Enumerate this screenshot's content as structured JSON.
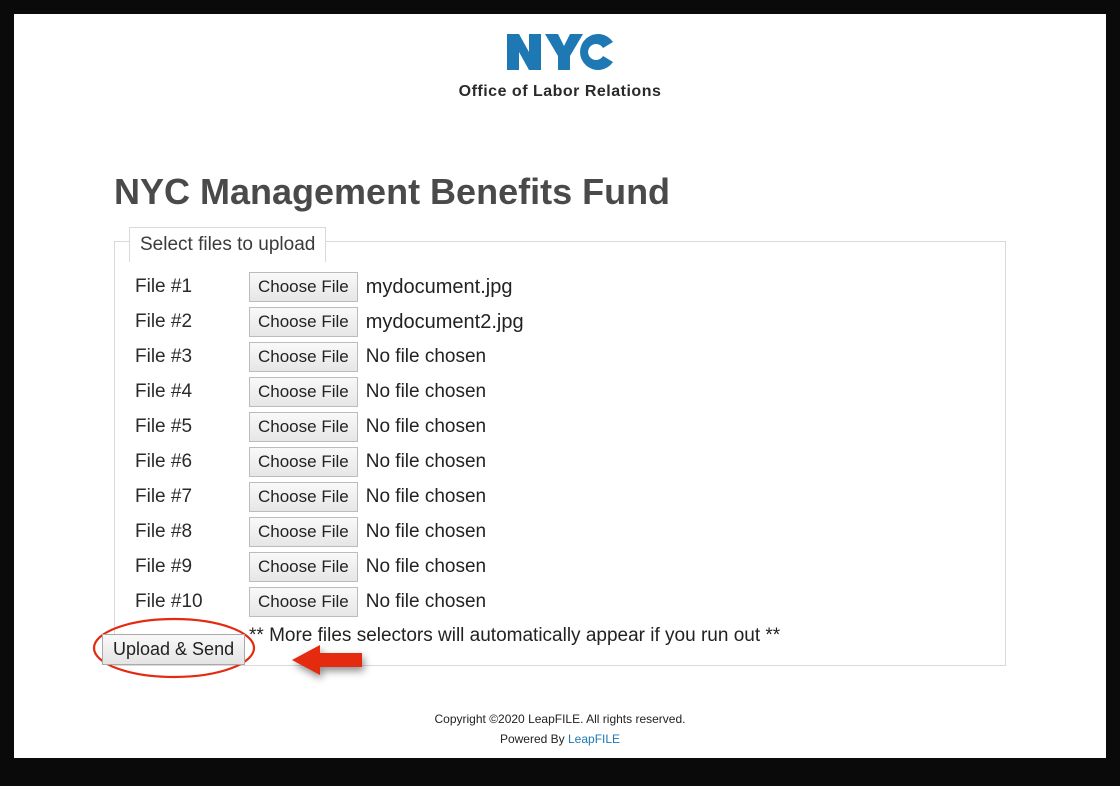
{
  "header": {
    "logo_text": "NYC",
    "subtitle": "Office of Labor Relations"
  },
  "main": {
    "title": "NYC Management Benefits Fund",
    "fieldset_legend": "Select files to upload",
    "choose_button_label": "Choose File",
    "no_file_label": "No file chosen",
    "files": [
      {
        "label": "File #1",
        "filename": "mydocument.jpg",
        "chosen": true
      },
      {
        "label": "File #2",
        "filename": "mydocument2.jpg",
        "chosen": true
      },
      {
        "label": "File #3",
        "filename": "No file chosen",
        "chosen": false
      },
      {
        "label": "File #4",
        "filename": "No file chosen",
        "chosen": false
      },
      {
        "label": "File #5",
        "filename": "No file chosen",
        "chosen": false
      },
      {
        "label": "File #6",
        "filename": "No file chosen",
        "chosen": false
      },
      {
        "label": "File #7",
        "filename": "No file chosen",
        "chosen": false
      },
      {
        "label": "File #8",
        "filename": "No file chosen",
        "chosen": false
      },
      {
        "label": "File #9",
        "filename": "No file chosen",
        "chosen": false
      },
      {
        "label": "File #10",
        "filename": "No file chosen",
        "chosen": false
      }
    ],
    "hint": "** More files selectors will automatically appear if you run out **",
    "upload_button_label": "Upload & Send"
  },
  "annotation": {
    "arrow_color": "#e42a0f",
    "ellipse_color": "#e42a0f"
  },
  "footer": {
    "copyright": "Copyright ©2020 LeapFILE. All rights reserved.",
    "powered_prefix": "Powered By ",
    "powered_link": "LeapFILE"
  }
}
